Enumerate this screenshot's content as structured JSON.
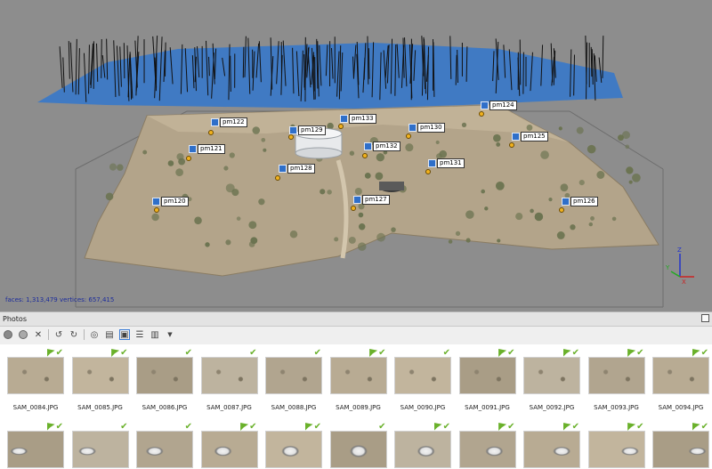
{
  "viewport": {
    "stats": "faces: 1,313,479 vertices: 657,415",
    "markers": [
      {
        "label": "pm122"
      },
      {
        "label": "pm129"
      },
      {
        "label": "pm133"
      },
      {
        "label": "pm130"
      },
      {
        "label": "pm124"
      },
      {
        "label": "pm121"
      },
      {
        "label": "pm132"
      },
      {
        "label": "pm125"
      },
      {
        "label": "pm128"
      },
      {
        "label": "pm131"
      },
      {
        "label": "pm120"
      },
      {
        "label": "pm127"
      },
      {
        "label": "pm126"
      }
    ],
    "axes": {
      "x": "X",
      "y": "Y",
      "z": "Z"
    },
    "colors": {
      "background": "#8d8d8d",
      "cameras": "#3c79c6",
      "terrain": "#b3a48a"
    }
  },
  "panel": {
    "title": "Photos",
    "toolbar_icons": [
      "enable-icon",
      "disable-icon",
      "remove-icon",
      "rotate-left-icon",
      "rotate-right-icon",
      "binoculars-icon",
      "filter-icon",
      "image-view-icon",
      "list-view-icon",
      "columns-icon",
      "dropdown-arrow-icon"
    ],
    "photos_row1": [
      "SAM_0084.JPG",
      "SAM_0085.JPG",
      "SAM_0086.JPG",
      "SAM_0087.JPG",
      "SAM_0088.JPG",
      "SAM_0089.JPG",
      "SAM_0090.JPG",
      "SAM_0091.JPG",
      "SAM_0092.JPG",
      "SAM_0093.JPG",
      "SAM_0094.JPG"
    ],
    "flags_row1": [
      true,
      true,
      false,
      false,
      false,
      true,
      false,
      true,
      true,
      true,
      true
    ],
    "flags_row2": [
      true,
      false,
      false,
      true,
      true,
      false,
      true,
      true,
      true,
      true,
      true
    ]
  }
}
